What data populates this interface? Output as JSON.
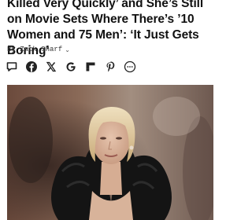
{
  "article": {
    "headline": "Killed Very Quickly’ and She’s Still on Movie Sets Where There’s ’10 Women and 75 Men’: ‘It Just Gets Boring’",
    "byline": "By Zack Sharf",
    "byline_chevron": "⌄"
  },
  "share_icons": [
    "comment-icon",
    "facebook-icon",
    "x-icon",
    "google-icon",
    "flipboard-icon",
    "pinterest-icon",
    "more-icon"
  ],
  "colors": {
    "headline": "#111111",
    "byline": "#333333",
    "icons": "#222222"
  },
  "photo": {
    "subject": "woman with blonde bob in black ruffled gown",
    "alt": ""
  }
}
